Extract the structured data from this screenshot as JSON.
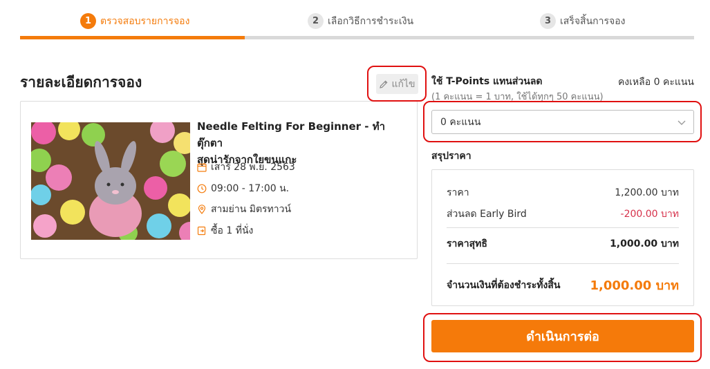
{
  "stepper": {
    "steps": [
      {
        "number": "1",
        "label": "ตรวจสอบรายการจอง",
        "active": true
      },
      {
        "number": "2",
        "label": "เลือกวิธีการชำระเงิน",
        "active": false
      },
      {
        "number": "3",
        "label": "เสร็จสิ้นการจอง",
        "active": false
      }
    ],
    "progress_fraction": 0.333,
    "accent_color": "#f47b0b"
  },
  "booking": {
    "title": "รายละเอียดการจอง",
    "edit_label": "แก้ไข",
    "event": {
      "title_line1": "Needle Felting For Beginner - ทำตุ๊กตา",
      "title_line2": "สุดน่ารักจากใยขนแกะ",
      "date": "เสาร์ 28 พ.ย. 2563",
      "time": "09:00 - 17:00 น.",
      "location": "สามย่าน มิตรทาวน์",
      "seats": "ซื้อ 1 ที่นั่ง",
      "icons": [
        "calendar-icon",
        "clock-icon",
        "location-pin-icon",
        "ticket-icon"
      ]
    }
  },
  "points": {
    "label": "ใช้ T-Points แทนส่วนลด",
    "sub": "(1 คะแนน = 1 บาท, ใช้ได้ทุกๆ 50 คะแนน)",
    "remaining": "คงเหลือ 0 คะแนน",
    "selected": "0 คะแนน"
  },
  "summary": {
    "label": "สรุปราคา",
    "price_label": "ราคา",
    "price_value": "1,200.00 บาท",
    "discount_label": "ส่วนลด Early Bird",
    "discount_value": "-200.00 บาท",
    "net_label": "ราคาสุทธิ",
    "net_value": "1,000.00 บาท",
    "total_label": "จำนวนเงินที่ต้องชำระทั้งสิ้น",
    "total_value": "1,000.00 บาท"
  },
  "actions": {
    "continue_label": "ดำเนินการต่อ"
  },
  "colors": {
    "accent": "#f47b0b",
    "discount": "#d6304a",
    "highlight": "#e01010"
  }
}
